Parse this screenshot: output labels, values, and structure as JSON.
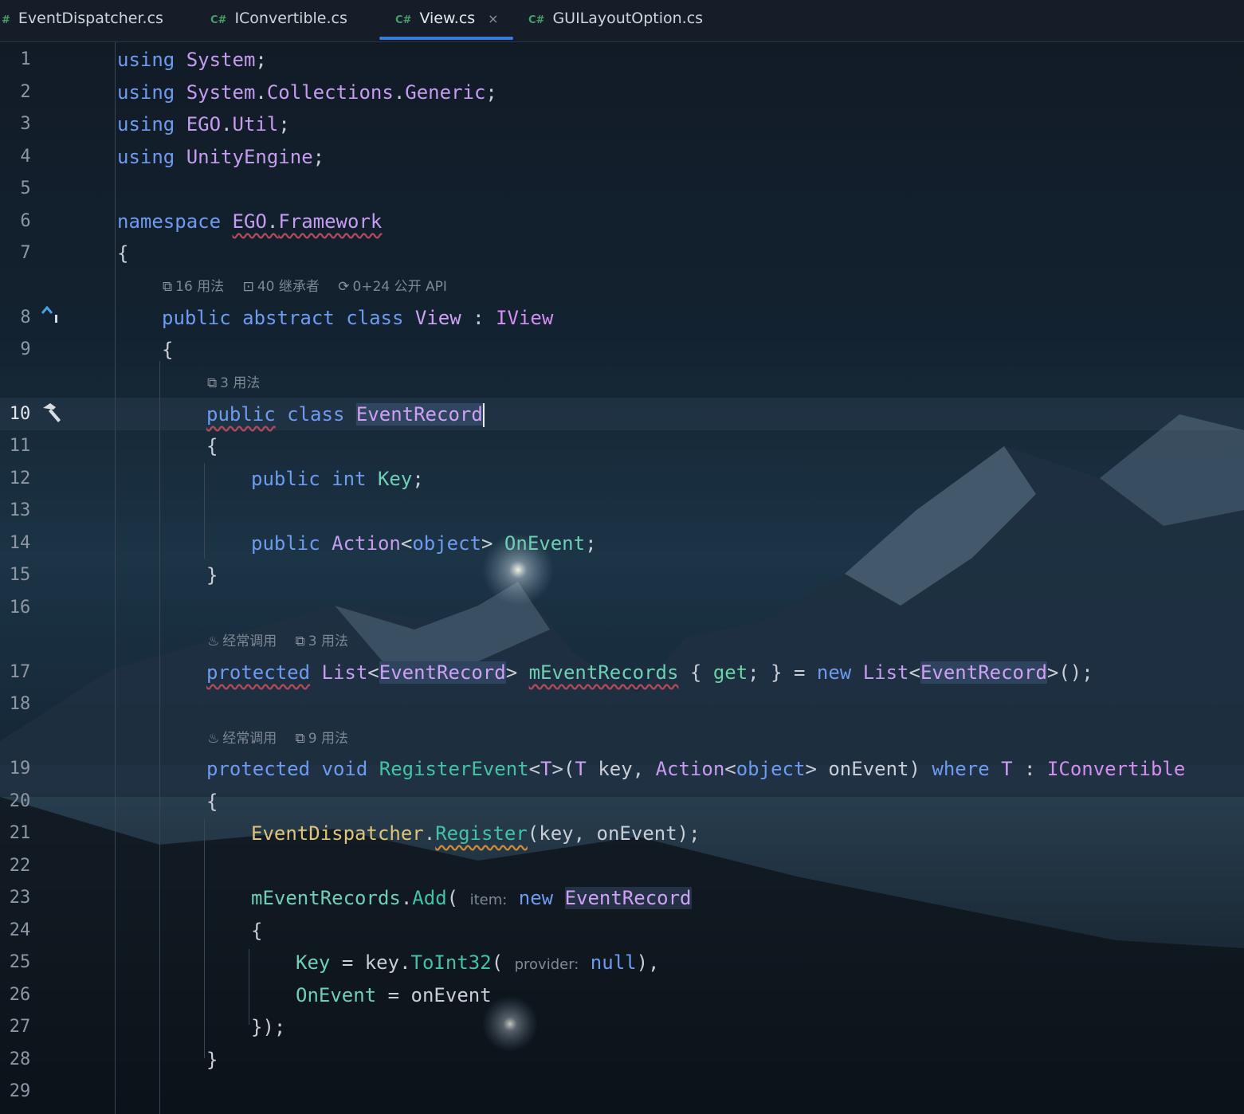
{
  "tabs": [
    {
      "prefix": "#",
      "label": "EventDispatcher.cs",
      "active": false
    },
    {
      "prefix": "C#",
      "label": "IConvertible.cs",
      "active": false
    },
    {
      "prefix": "C#",
      "label": "View.cs",
      "active": true,
      "close": "×"
    },
    {
      "prefix": "C#",
      "label": "GUILayoutOption.cs",
      "active": false
    }
  ],
  "line_numbers": [
    "1",
    "2",
    "3",
    "4",
    "5",
    "6",
    "7",
    "8",
    "9",
    "10",
    "11",
    "12",
    "13",
    "14",
    "15",
    "16",
    "17",
    "18",
    "19",
    "20",
    "21",
    "22",
    "23",
    "24",
    "25",
    "26",
    "27",
    "28",
    "29"
  ],
  "hints": {
    "class_view": {
      "usages": "16 用法",
      "inheritors": "40 继承者",
      "api": "0+24 公开 API"
    },
    "event_record": {
      "usages": "3 用法"
    },
    "m_event_records": {
      "frequent": "经常调用",
      "usages": "3 用法"
    },
    "register_event": {
      "frequent": "经常调用",
      "usages": "9 用法"
    }
  },
  "code": {
    "l1": {
      "kw": "using",
      "ns": "System",
      "end": ";"
    },
    "l2": {
      "kw": "using",
      "ns1": "System",
      "d1": ".",
      "ns2": "Collections",
      "d2": ".",
      "ns3": "Generic",
      "end": ";"
    },
    "l3": {
      "kw": "using",
      "ns1": "EGO",
      "d1": ".",
      "ns2": "Util",
      "end": ";"
    },
    "l4": {
      "kw": "using",
      "ns": "UnityEngine",
      "end": ";"
    },
    "l6": {
      "kw": "namespace",
      "ns1": "EGO",
      "d1": ".",
      "ns2": "Framework"
    },
    "l7": {
      "brace": "{"
    },
    "l8": {
      "k1": "public",
      "k2": "abstract",
      "k3": "class",
      "name": "View",
      "colon": ":",
      "iface": "IView"
    },
    "l9": {
      "brace": "{"
    },
    "l10": {
      "k1": "public",
      "k2": "class",
      "name": "EventRecord"
    },
    "l11": {
      "brace": "{"
    },
    "l12": {
      "k1": "public",
      "k2": "int",
      "field": "Key",
      "end": ";"
    },
    "l14": {
      "k1": "public",
      "type": "Action",
      "lt": "<",
      "arg": "object",
      "gt": ">",
      "field": "OnEvent",
      "end": ";"
    },
    "l15": {
      "brace": "}"
    },
    "l17": {
      "k1": "protected",
      "type": "List",
      "lt": "<",
      "arg": "EventRecord",
      "gt": ">",
      "prop": "mEventRecords",
      "ob": "{",
      "get": "get",
      "semi": ";",
      "cb": "}",
      "eq": "=",
      "new": "new",
      "type2": "List",
      "lt2": "<",
      "arg2": "EventRecord",
      "gt2": ">",
      "end": "();"
    },
    "l19": {
      "k1": "protected",
      "k2": "void",
      "fn": "RegisterEvent",
      "lt": "<",
      "tp": "T",
      "gt": ">",
      "op": "(",
      "ptype": "T",
      "pname": "key",
      "comma": ",",
      "atype": "Action",
      "alt": "<",
      "aarg": "object",
      "agt": ">",
      "aname": "onEvent",
      "cp": ")",
      "where": "where",
      "wt": "T",
      "colon": ":",
      "iface": "IConvertible"
    },
    "l20": {
      "brace": "{"
    },
    "l21": {
      "cls": "EventDispatcher",
      "dot": ".",
      "method": "Register",
      "op": "(",
      "a1": "key",
      "comma": ",",
      "a2": "onEvent",
      "end": ");"
    },
    "l23": {
      "prop": "mEventRecords",
      "dot": ".",
      "method": "Add",
      "op": "(",
      "hint": "item:",
      "new": "new",
      "cls": "EventRecord"
    },
    "l24": {
      "brace": "{"
    },
    "l25": {
      "field": "Key",
      "eq": "=",
      "obj": "key",
      "dot": ".",
      "method": "ToInt32",
      "op": "(",
      "hint": "provider:",
      "val": "null",
      "end": "),"
    },
    "l26": {
      "field": "OnEvent",
      "eq": "=",
      "val": "onEvent"
    },
    "l27": {
      "end": "});"
    },
    "l28": {
      "brace": "}"
    }
  },
  "gutter_icons": {
    "line8": "implementation-up-icon",
    "line10": "hammer-icon"
  },
  "colors": {
    "accent": "#3d79d6",
    "keyword": "#6e9bf0",
    "type": "#c59cf0",
    "member": "#6fcfb4"
  }
}
